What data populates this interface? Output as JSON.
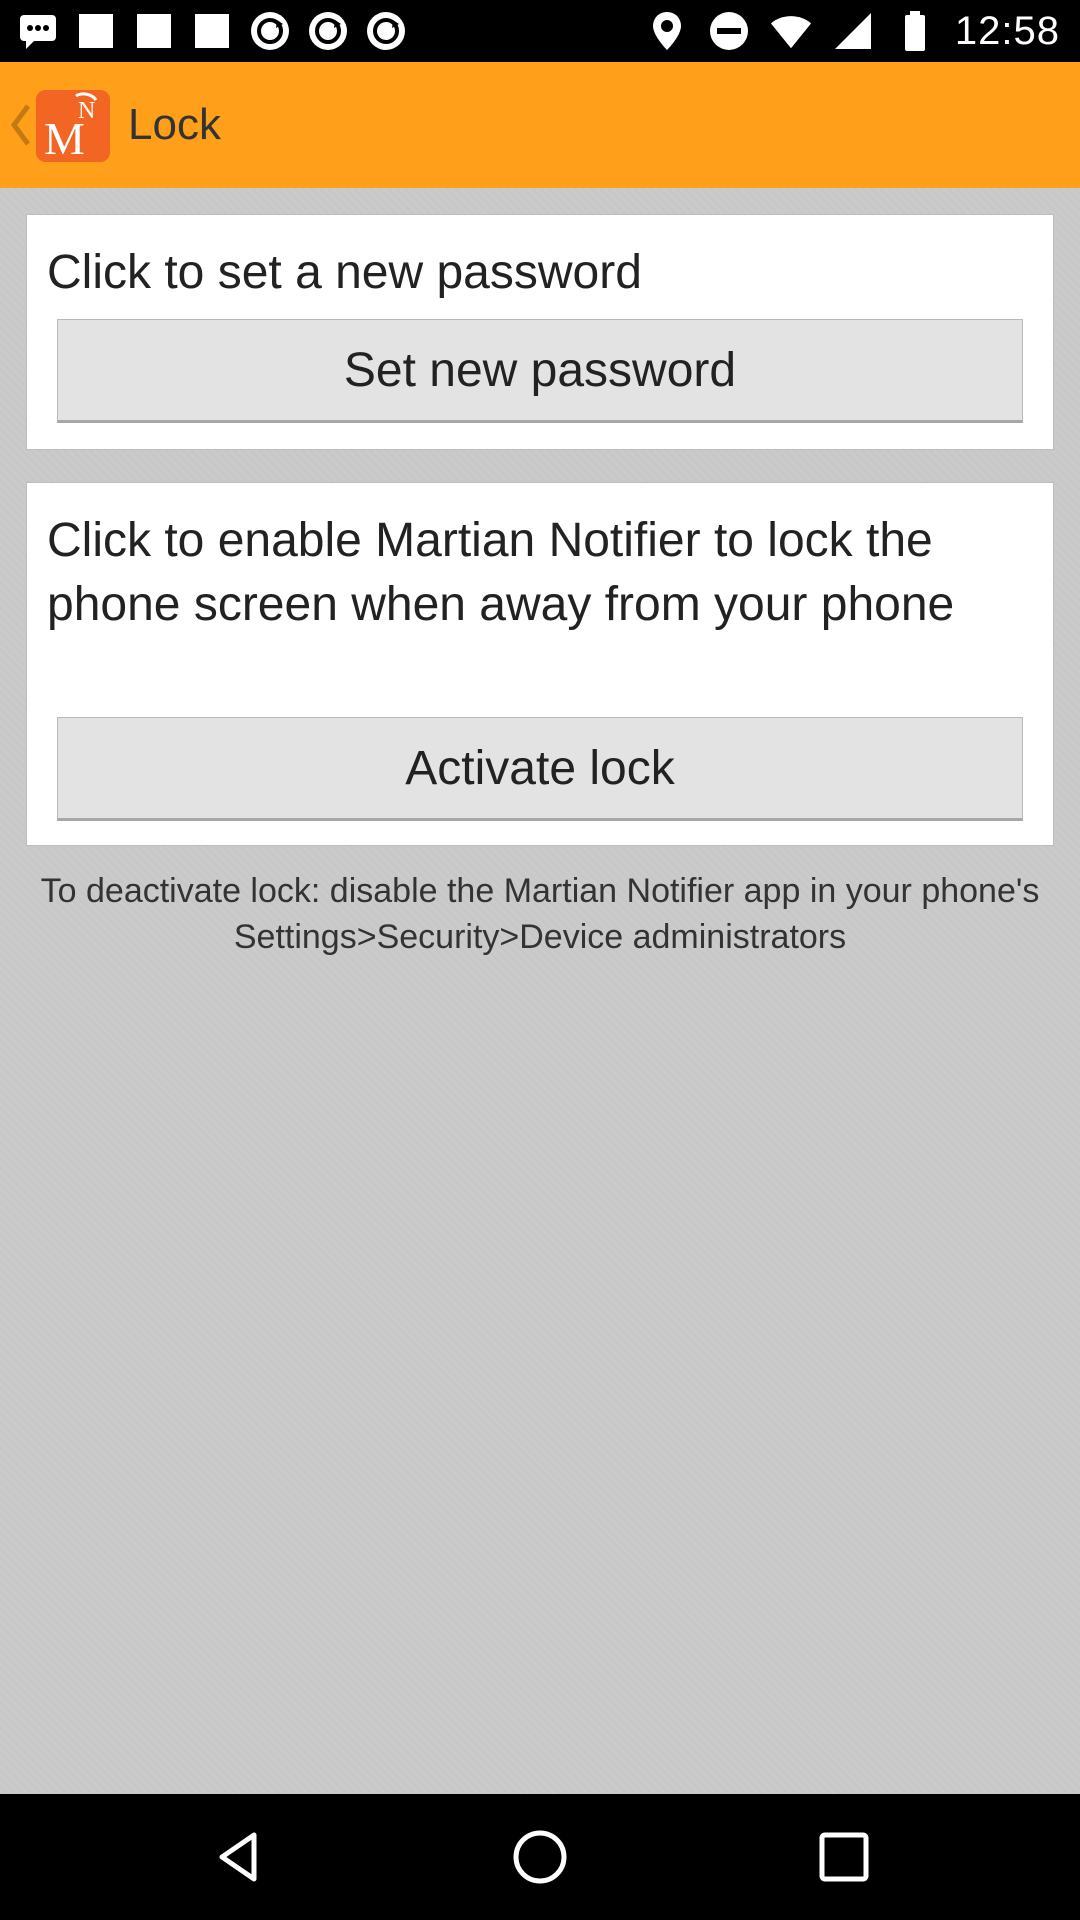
{
  "status_bar": {
    "time": "12:58",
    "left_icons": [
      "chat-icon",
      "image-icon",
      "image-icon",
      "image-icon",
      "sync-icon",
      "sync-icon",
      "sync-icon"
    ],
    "right_icons": [
      "location-icon",
      "do-not-disturb-icon",
      "wifi-icon",
      "signal-icon",
      "battery-icon"
    ]
  },
  "app_bar": {
    "title": "Lock",
    "accent_color": "#ff9f1a"
  },
  "cards": {
    "password": {
      "description": "Click to set a new password",
      "button_label": "Set new password"
    },
    "lock": {
      "description": "Click to enable Martian Notifier to lock the phone screen when away from your phone",
      "button_label": "Activate lock"
    }
  },
  "note": "To deactivate lock: disable the Martian Notifier app in your phone's Settings>Security>Device administrators",
  "nav": {
    "icons": [
      "back-icon",
      "home-icon",
      "recents-icon"
    ]
  }
}
